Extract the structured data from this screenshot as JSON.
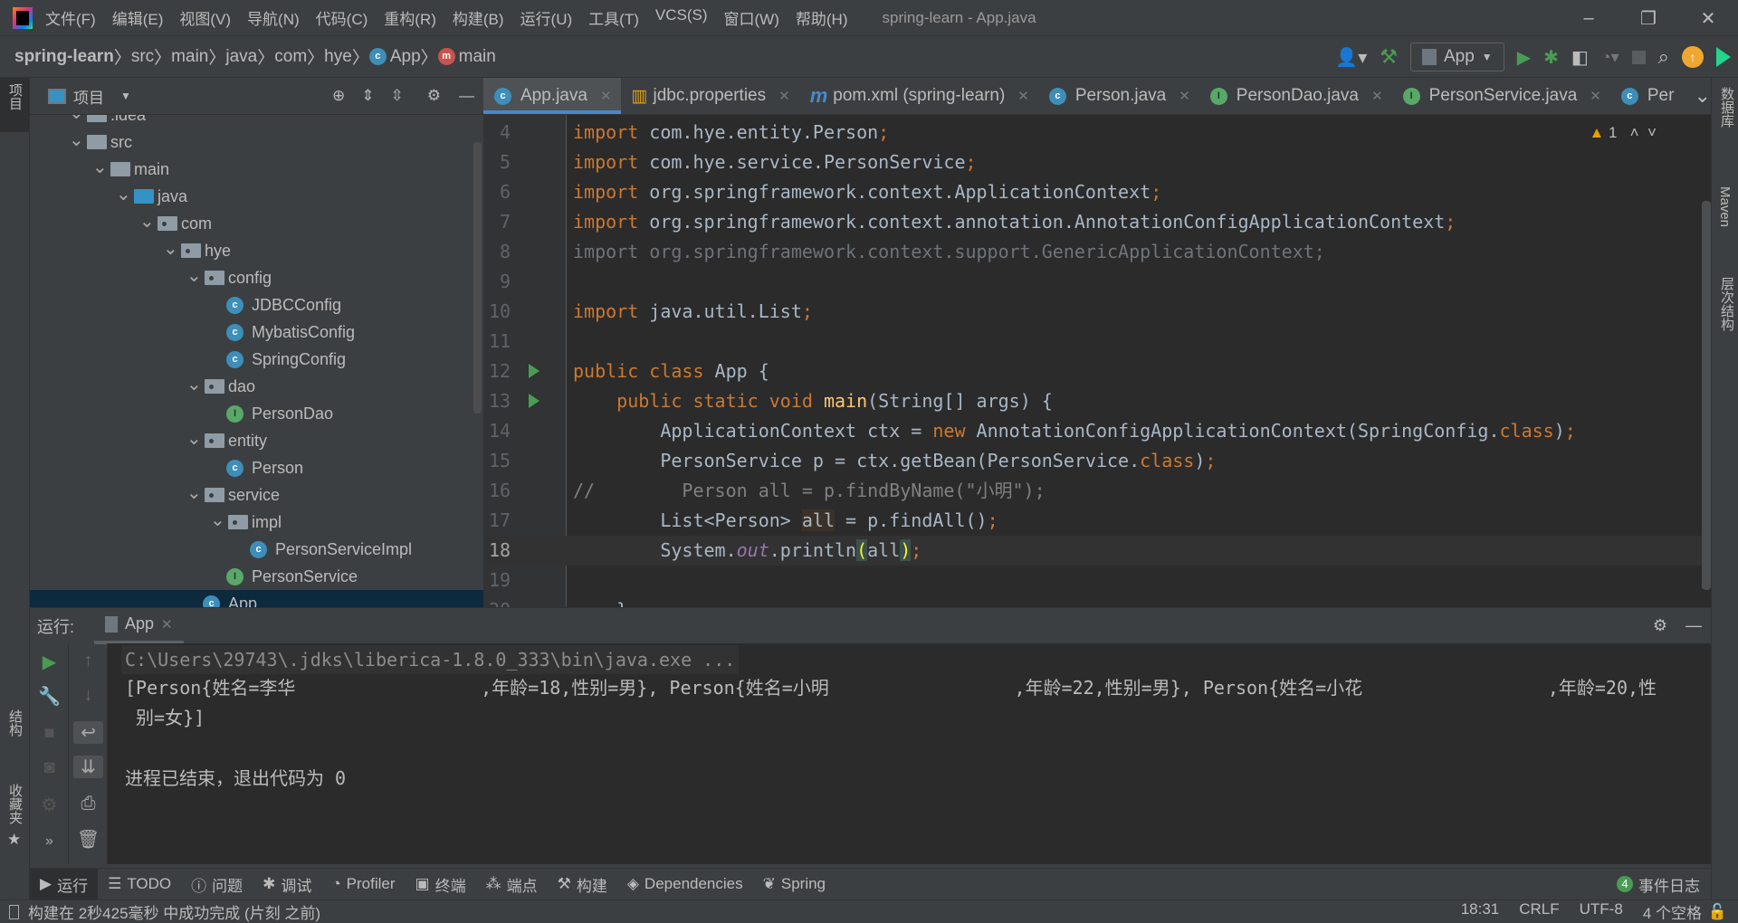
{
  "window": {
    "title": "spring-learn - App.java",
    "menu": [
      "文件(F)",
      "编辑(E)",
      "视图(V)",
      "导航(N)",
      "代码(C)",
      "重构(R)",
      "构建(B)",
      "运行(U)",
      "工具(T)",
      "VCS(S)",
      "窗口(W)",
      "帮助(H)"
    ],
    "minimize": "–",
    "maximize": "❐",
    "close": "✕"
  },
  "breadcrumb": [
    "spring-learn",
    "src",
    "main",
    "java",
    "com",
    "hye",
    "App",
    "main"
  ],
  "toolbar": {
    "run_config": "App"
  },
  "left_stripe": {
    "project": "项目",
    "structure": "结构",
    "favorites": "收藏夹"
  },
  "right_stripe": {
    "database": "数据库",
    "maven": "Maven",
    "hierarchy": "层次结构"
  },
  "project": {
    "title": "项目",
    "tree": [
      {
        "depth": 1,
        "type": "folder",
        "label": ".idea",
        "expanded": true
      },
      {
        "depth": 1,
        "type": "folder",
        "label": "src",
        "expanded": true
      },
      {
        "depth": 2,
        "type": "folder",
        "label": "main",
        "expanded": true
      },
      {
        "depth": 3,
        "type": "src",
        "label": "java",
        "expanded": true
      },
      {
        "depth": 4,
        "type": "pkg",
        "label": "com",
        "expanded": true
      },
      {
        "depth": 5,
        "type": "pkg",
        "label": "hye",
        "expanded": true
      },
      {
        "depth": 6,
        "type": "pkg",
        "label": "config",
        "expanded": true
      },
      {
        "depth": 7,
        "type": "class",
        "label": "JDBCConfig"
      },
      {
        "depth": 7,
        "type": "class",
        "label": "MybatisConfig"
      },
      {
        "depth": 7,
        "type": "class",
        "label": "SpringConfig"
      },
      {
        "depth": 6,
        "type": "pkg",
        "label": "dao",
        "expanded": true
      },
      {
        "depth": 7,
        "type": "interface",
        "label": "PersonDao"
      },
      {
        "depth": 6,
        "type": "pkg",
        "label": "entity",
        "expanded": true
      },
      {
        "depth": 7,
        "type": "class",
        "label": "Person"
      },
      {
        "depth": 6,
        "type": "pkg",
        "label": "service",
        "expanded": true
      },
      {
        "depth": 7,
        "type": "pkg",
        "label": "impl",
        "expanded": true
      },
      {
        "depth": 8,
        "type": "class",
        "label": "PersonServiceImpl"
      },
      {
        "depth": 7,
        "type": "interface",
        "label": "PersonService"
      },
      {
        "depth": 6,
        "type": "class",
        "label": "App",
        "selected": true
      }
    ]
  },
  "tabs": [
    {
      "label": "App.java",
      "icon": "class",
      "active": true
    },
    {
      "label": "jdbc.properties",
      "icon": "properties"
    },
    {
      "label": "pom.xml (spring-learn)",
      "icon": "maven"
    },
    {
      "label": "Person.java",
      "icon": "class"
    },
    {
      "label": "PersonDao.java",
      "icon": "interface"
    },
    {
      "label": "PersonService.java",
      "icon": "interface"
    },
    {
      "label": "Per",
      "icon": "class"
    }
  ],
  "editor": {
    "warnings": "1",
    "current_line": 18
  },
  "code": [
    {
      "n": "4",
      "t": [
        [
          "kw",
          "import"
        ],
        [
          "",
          " com.hye.entity.Person"
        ],
        [
          "semi",
          ";"
        ]
      ]
    },
    {
      "n": "5",
      "t": [
        [
          "kw",
          "import"
        ],
        [
          "",
          " com.hye.service.PersonService"
        ],
        [
          "semi",
          ";"
        ]
      ]
    },
    {
      "n": "6",
      "t": [
        [
          "kw",
          "import"
        ],
        [
          "",
          " org.springframework.context.ApplicationContext"
        ],
        [
          "semi",
          ";"
        ]
      ]
    },
    {
      "n": "7",
      "t": [
        [
          "kw",
          "import"
        ],
        [
          "",
          " org.springframework.context.annotation.AnnotationConfigApplicationContext"
        ],
        [
          "semi",
          ";"
        ]
      ]
    },
    {
      "n": "8",
      "t": [
        [
          "gray",
          "import org.springframework.context.support.GenericApplicationContext;"
        ]
      ]
    },
    {
      "n": "9",
      "t": []
    },
    {
      "n": "10",
      "t": [
        [
          "kw",
          "import"
        ],
        [
          "",
          " java.util.List"
        ],
        [
          "semi",
          ";"
        ]
      ]
    },
    {
      "n": "11",
      "t": []
    },
    {
      "n": "12",
      "run": true,
      "t": [
        [
          "kw",
          "public class"
        ],
        [
          "",
          " App {"
        ]
      ]
    },
    {
      "n": "13",
      "run": true,
      "t": [
        [
          "",
          "    "
        ],
        [
          "kw",
          "public static void"
        ],
        [
          "",
          " "
        ],
        [
          "fn",
          "main"
        ],
        [
          "",
          "(String[] args) {"
        ]
      ]
    },
    {
      "n": "14",
      "t": [
        [
          "",
          "        ApplicationContext ctx = "
        ],
        [
          "kw",
          "new"
        ],
        [
          "",
          " AnnotationConfigApplicationContext(SpringConfig."
        ],
        [
          "kw",
          "class"
        ],
        [
          "",
          ")"
        ],
        [
          "semi",
          ";"
        ]
      ]
    },
    {
      "n": "15",
      "t": [
        [
          "",
          "        PersonService p = ctx.getBean(PersonService."
        ],
        [
          "kw",
          "class"
        ],
        [
          "",
          ")"
        ],
        [
          "semi",
          ";"
        ]
      ]
    },
    {
      "n": "16",
      "t": [
        [
          "cm",
          "//        Person all = p.findByName(\"小明\");"
        ]
      ]
    },
    {
      "n": "17",
      "t": [
        [
          "",
          "        List<Person> "
        ],
        [
          "hl",
          "all"
        ],
        [
          "",
          " = p.findAll()"
        ],
        [
          "semi",
          ";"
        ]
      ]
    },
    {
      "n": "18",
      "t": [
        [
          "",
          "        System."
        ],
        [
          "st",
          "out"
        ],
        [
          "",
          ".println"
        ],
        [
          "br",
          "("
        ],
        [
          "",
          "all"
        ],
        [
          "br",
          ")"
        ],
        [
          "semi",
          ";"
        ]
      ]
    },
    {
      "n": "19",
      "t": []
    },
    {
      "n": "20",
      "t": [
        [
          "",
          "    }"
        ]
      ]
    }
  ],
  "run": {
    "label": "运行:",
    "tab": "App",
    "console": [
      "C:\\Users\\29743\\.jdks\\liberica-1.8.0_333\\bin\\java.exe ...",
      "[Person{姓名=李华                 ,年龄=18,性别=男}, Person{姓名=小明                 ,年龄=22,性别=男}, Person{姓名=小花                 ,年龄=20,性",
      " 别=女}]",
      "进程已结束，退出代码为 0"
    ]
  },
  "bottom_tabs": [
    "运行",
    "TODO",
    "问题",
    "调试",
    "Profiler",
    "终端",
    "端点",
    "构建",
    "Dependencies",
    "Spring"
  ],
  "event_log": {
    "count": "4",
    "label": "事件日志"
  },
  "status": {
    "message": "构建在 2秒425毫秒 中成功完成 (片刻 之前)",
    "position": "18:31",
    "line_sep": "CRLF",
    "encoding": "UTF-8",
    "indent": "4 个空格"
  },
  "colors": {
    "keyword": "#cc7832",
    "text": "#a9b7c6",
    "editor_bg": "#2b2b2b",
    "panel_bg": "#3c3f41",
    "run_green": "#499c54",
    "class_icon": "#3d8eb9",
    "interface_icon": "#59a869"
  }
}
